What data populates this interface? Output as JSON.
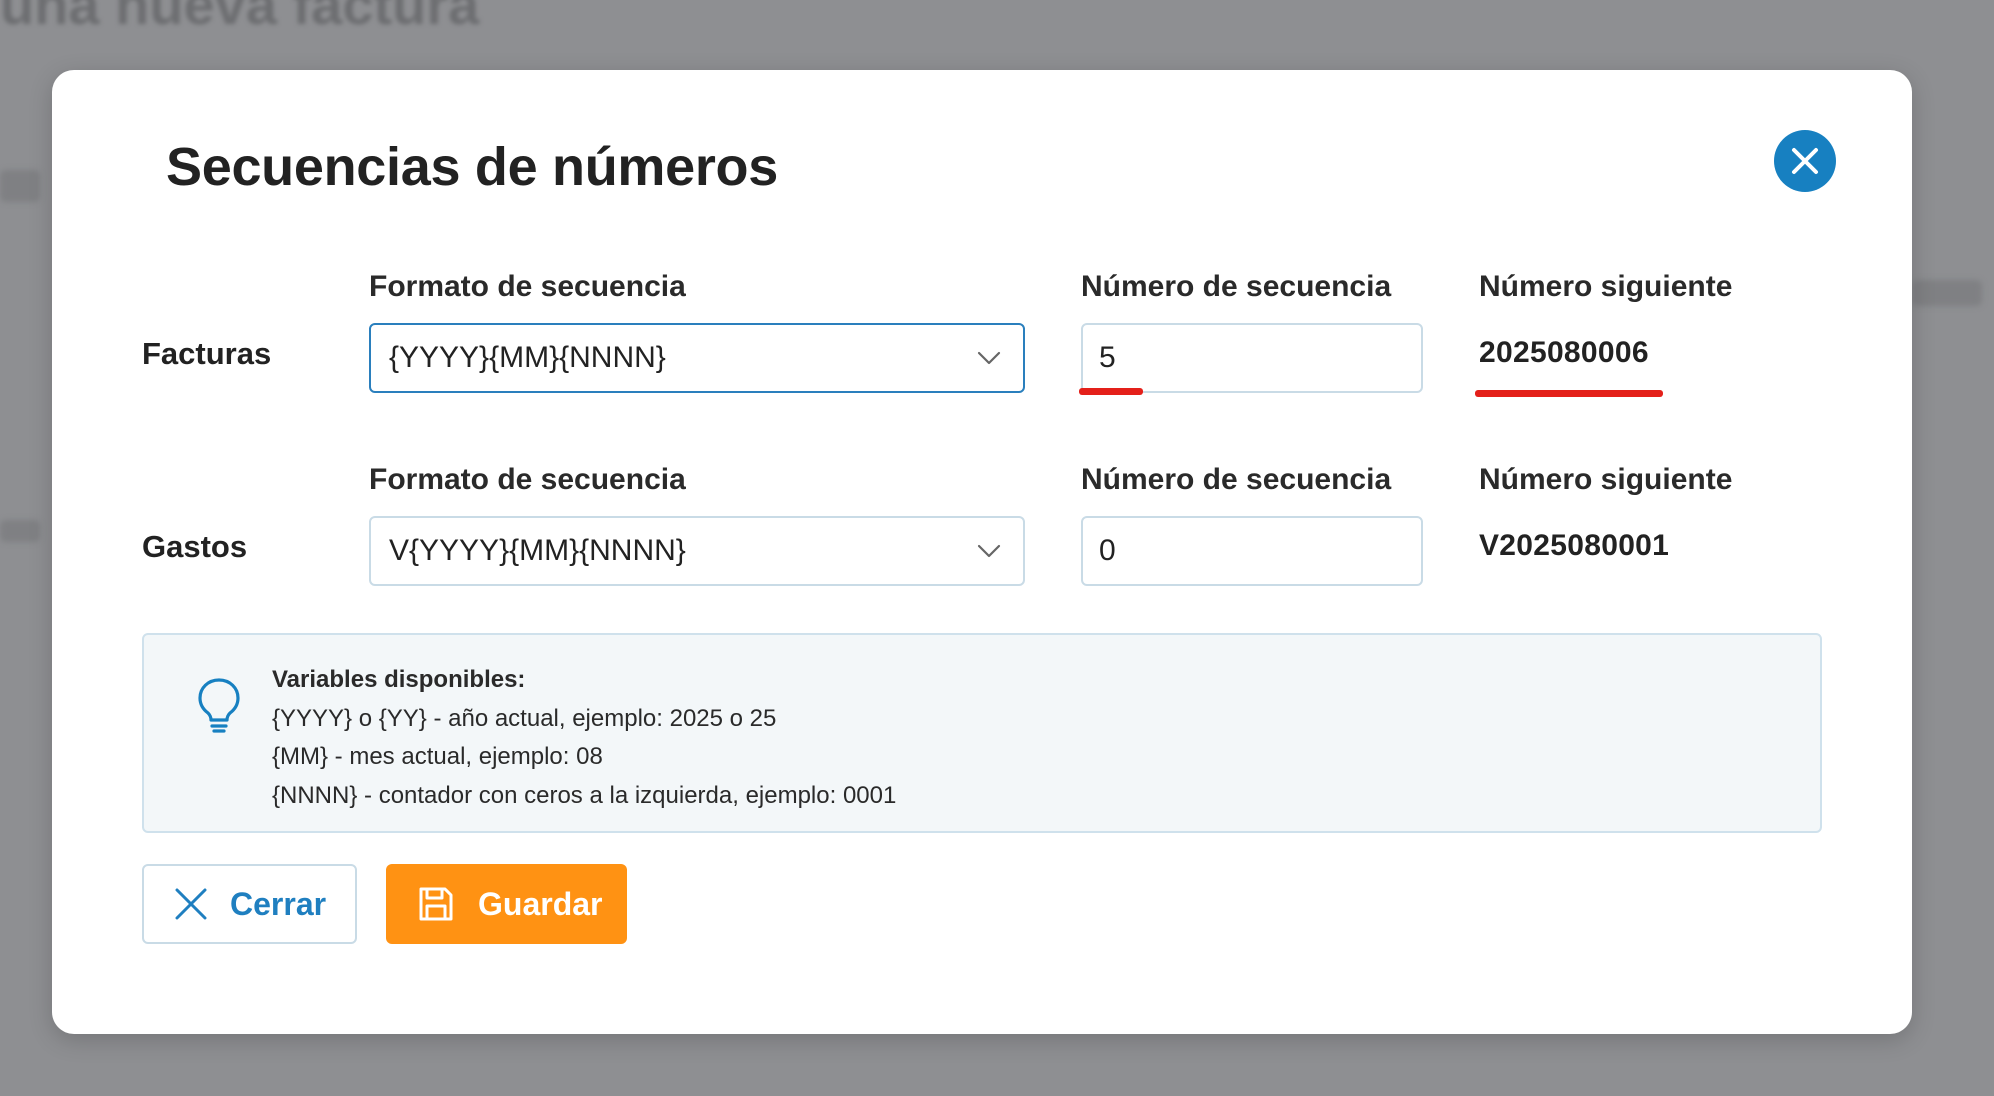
{
  "modal": {
    "title": "Secuencias de números",
    "close_icon": "close-icon"
  },
  "rows": [
    {
      "label": "Facturas",
      "format_label": "Formato de secuencia",
      "format_value": "{YYYY}{MM}{NNNN}",
      "sequence_label": "Número de secuencia",
      "sequence_value": "5",
      "next_label": "Número siguiente",
      "next_value": "2025080006"
    },
    {
      "label": "Gastos",
      "format_label": "Formato de secuencia",
      "format_value": "V{YYYY}{MM}{NNNN}",
      "sequence_label": "Número de secuencia",
      "sequence_value": "0",
      "next_label": "Número siguiente",
      "next_value": "V2025080001"
    }
  ],
  "info": {
    "icon": "lightbulb-icon",
    "heading": "Variables disponibles:",
    "lines": [
      "{YYYY} o {YY} - año actual, ejemplo: 2025 o 25",
      "{MM} - mes actual, ejemplo: 08",
      "{NNNN} - contador con ceros a la izquierda, ejemplo: 0001"
    ]
  },
  "buttons": {
    "close_label": "Cerrar",
    "save_label": "Guardar"
  },
  "colors": {
    "accent": "#1780c1",
    "primary_button": "#ff9213",
    "annotation_underline": "#e4201a"
  }
}
